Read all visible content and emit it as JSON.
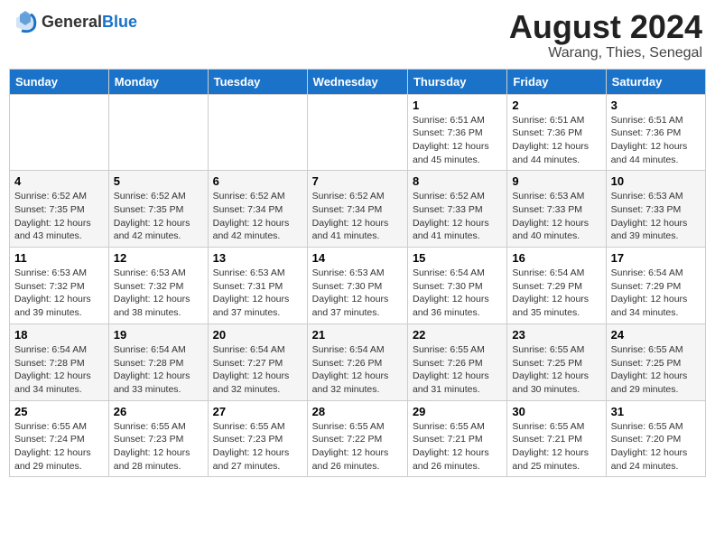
{
  "header": {
    "logo_general": "General",
    "logo_blue": "Blue",
    "month_year": "August 2024",
    "location": "Warang, Thies, Senegal"
  },
  "days_of_week": [
    "Sunday",
    "Monday",
    "Tuesday",
    "Wednesday",
    "Thursday",
    "Friday",
    "Saturday"
  ],
  "weeks": [
    [
      {
        "day": "",
        "info": ""
      },
      {
        "day": "",
        "info": ""
      },
      {
        "day": "",
        "info": ""
      },
      {
        "day": "",
        "info": ""
      },
      {
        "day": "1",
        "info": "Sunrise: 6:51 AM\nSunset: 7:36 PM\nDaylight: 12 hours\nand 45 minutes."
      },
      {
        "day": "2",
        "info": "Sunrise: 6:51 AM\nSunset: 7:36 PM\nDaylight: 12 hours\nand 44 minutes."
      },
      {
        "day": "3",
        "info": "Sunrise: 6:51 AM\nSunset: 7:36 PM\nDaylight: 12 hours\nand 44 minutes."
      }
    ],
    [
      {
        "day": "4",
        "info": "Sunrise: 6:52 AM\nSunset: 7:35 PM\nDaylight: 12 hours\nand 43 minutes."
      },
      {
        "day": "5",
        "info": "Sunrise: 6:52 AM\nSunset: 7:35 PM\nDaylight: 12 hours\nand 42 minutes."
      },
      {
        "day": "6",
        "info": "Sunrise: 6:52 AM\nSunset: 7:34 PM\nDaylight: 12 hours\nand 42 minutes."
      },
      {
        "day": "7",
        "info": "Sunrise: 6:52 AM\nSunset: 7:34 PM\nDaylight: 12 hours\nand 41 minutes."
      },
      {
        "day": "8",
        "info": "Sunrise: 6:52 AM\nSunset: 7:33 PM\nDaylight: 12 hours\nand 41 minutes."
      },
      {
        "day": "9",
        "info": "Sunrise: 6:53 AM\nSunset: 7:33 PM\nDaylight: 12 hours\nand 40 minutes."
      },
      {
        "day": "10",
        "info": "Sunrise: 6:53 AM\nSunset: 7:33 PM\nDaylight: 12 hours\nand 39 minutes."
      }
    ],
    [
      {
        "day": "11",
        "info": "Sunrise: 6:53 AM\nSunset: 7:32 PM\nDaylight: 12 hours\nand 39 minutes."
      },
      {
        "day": "12",
        "info": "Sunrise: 6:53 AM\nSunset: 7:32 PM\nDaylight: 12 hours\nand 38 minutes."
      },
      {
        "day": "13",
        "info": "Sunrise: 6:53 AM\nSunset: 7:31 PM\nDaylight: 12 hours\nand 37 minutes."
      },
      {
        "day": "14",
        "info": "Sunrise: 6:53 AM\nSunset: 7:30 PM\nDaylight: 12 hours\nand 37 minutes."
      },
      {
        "day": "15",
        "info": "Sunrise: 6:54 AM\nSunset: 7:30 PM\nDaylight: 12 hours\nand 36 minutes."
      },
      {
        "day": "16",
        "info": "Sunrise: 6:54 AM\nSunset: 7:29 PM\nDaylight: 12 hours\nand 35 minutes."
      },
      {
        "day": "17",
        "info": "Sunrise: 6:54 AM\nSunset: 7:29 PM\nDaylight: 12 hours\nand 34 minutes."
      }
    ],
    [
      {
        "day": "18",
        "info": "Sunrise: 6:54 AM\nSunset: 7:28 PM\nDaylight: 12 hours\nand 34 minutes."
      },
      {
        "day": "19",
        "info": "Sunrise: 6:54 AM\nSunset: 7:28 PM\nDaylight: 12 hours\nand 33 minutes."
      },
      {
        "day": "20",
        "info": "Sunrise: 6:54 AM\nSunset: 7:27 PM\nDaylight: 12 hours\nand 32 minutes."
      },
      {
        "day": "21",
        "info": "Sunrise: 6:54 AM\nSunset: 7:26 PM\nDaylight: 12 hours\nand 32 minutes."
      },
      {
        "day": "22",
        "info": "Sunrise: 6:55 AM\nSunset: 7:26 PM\nDaylight: 12 hours\nand 31 minutes."
      },
      {
        "day": "23",
        "info": "Sunrise: 6:55 AM\nSunset: 7:25 PM\nDaylight: 12 hours\nand 30 minutes."
      },
      {
        "day": "24",
        "info": "Sunrise: 6:55 AM\nSunset: 7:25 PM\nDaylight: 12 hours\nand 29 minutes."
      }
    ],
    [
      {
        "day": "25",
        "info": "Sunrise: 6:55 AM\nSunset: 7:24 PM\nDaylight: 12 hours\nand 29 minutes."
      },
      {
        "day": "26",
        "info": "Sunrise: 6:55 AM\nSunset: 7:23 PM\nDaylight: 12 hours\nand 28 minutes."
      },
      {
        "day": "27",
        "info": "Sunrise: 6:55 AM\nSunset: 7:23 PM\nDaylight: 12 hours\nand 27 minutes."
      },
      {
        "day": "28",
        "info": "Sunrise: 6:55 AM\nSunset: 7:22 PM\nDaylight: 12 hours\nand 26 minutes."
      },
      {
        "day": "29",
        "info": "Sunrise: 6:55 AM\nSunset: 7:21 PM\nDaylight: 12 hours\nand 26 minutes."
      },
      {
        "day": "30",
        "info": "Sunrise: 6:55 AM\nSunset: 7:21 PM\nDaylight: 12 hours\nand 25 minutes."
      },
      {
        "day": "31",
        "info": "Sunrise: 6:55 AM\nSunset: 7:20 PM\nDaylight: 12 hours\nand 24 minutes."
      }
    ]
  ]
}
